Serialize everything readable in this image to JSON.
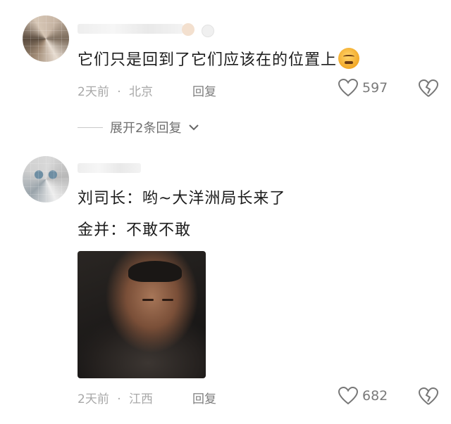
{
  "comments": [
    {
      "text": "它们只是回到了它们应该在的位置上",
      "text_emoji": "smirk-face-icon",
      "time": "2天前",
      "separator": "·",
      "location": "北京",
      "reply_label": "回复",
      "likes": "597",
      "expand_label": "展开2条回复"
    },
    {
      "lines": [
        "刘司长：哟~大洋洲局长来了",
        "金并：不敢不敢"
      ],
      "time": "2天前",
      "separator": "·",
      "location": "江西",
      "reply_label": "回复",
      "likes": "682",
      "image": "film-still-man-in-dark-coat"
    }
  ],
  "icons": {
    "like": "heart-outline-icon",
    "dislike": "broken-heart-icon",
    "expand": "chevron-down-icon"
  },
  "colors": {
    "meta": "#a8a8a8",
    "body_text": "#1d1d1d",
    "background": "#ffffff"
  }
}
